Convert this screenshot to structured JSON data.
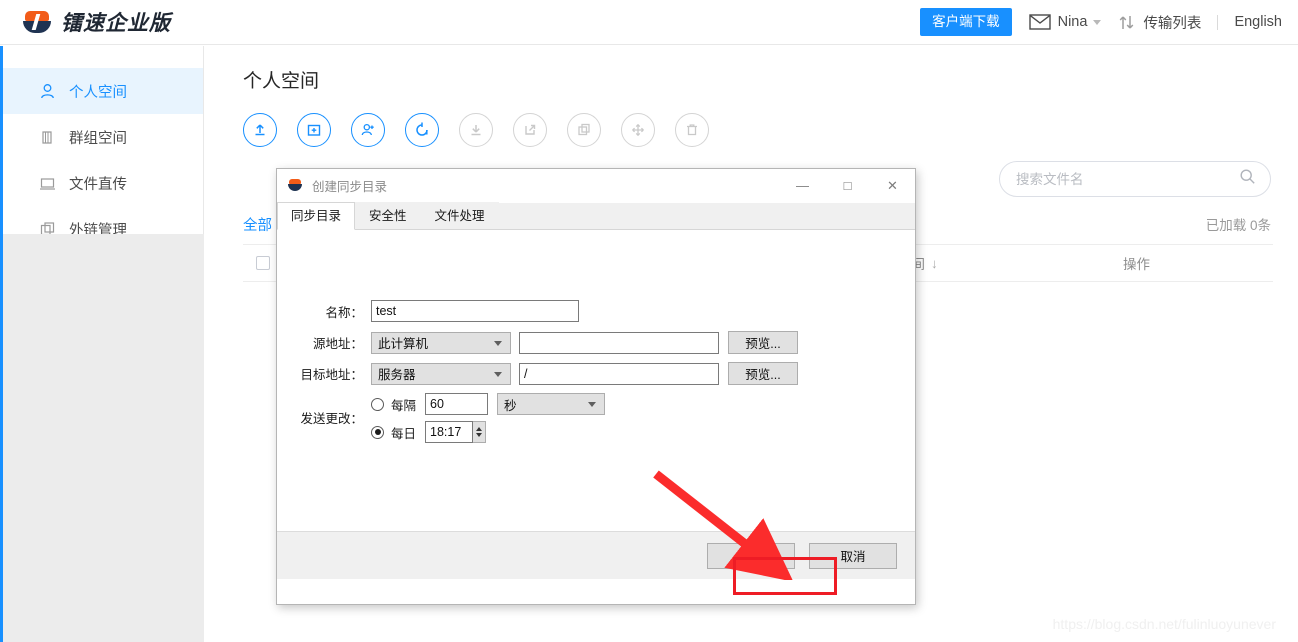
{
  "header": {
    "logo_text": "镭速企业版",
    "client_download": "客户端下载",
    "mail_icon": "mail-icon",
    "user_name": "Nina",
    "transfer_icon": "transfer-icon",
    "transfer_label": "传输列表",
    "language": "English"
  },
  "sidebar": {
    "items": [
      {
        "label": "个人空间",
        "icon": "person-icon",
        "active": true
      },
      {
        "label": "群组空间",
        "icon": "group-icon",
        "active": false
      },
      {
        "label": "文件直传",
        "icon": "monitor-icon",
        "active": false
      },
      {
        "label": "外链管理",
        "icon": "link-icon",
        "active": false
      }
    ]
  },
  "main": {
    "page_title": "个人空间",
    "toolbar": [
      {
        "name": "upload-icon",
        "label": "上传",
        "enabled": true
      },
      {
        "name": "new-folder-icon",
        "label": "新建文件夹",
        "enabled": true
      },
      {
        "name": "add-user-icon",
        "label": "共享",
        "enabled": true
      },
      {
        "name": "sync-icon",
        "label": "同步",
        "enabled": true
      },
      {
        "name": "download-icon",
        "label": "下载",
        "enabled": false
      },
      {
        "name": "external-link-icon",
        "label": "外链",
        "enabled": false
      },
      {
        "name": "copy-icon",
        "label": "复制",
        "enabled": false
      },
      {
        "name": "move-icon",
        "label": "移动",
        "enabled": false
      },
      {
        "name": "delete-icon",
        "label": "删除",
        "enabled": false
      }
    ],
    "search": {
      "value": "",
      "placeholder": "搜索文件名",
      "icon": "search-icon"
    },
    "tab_all": "全部",
    "loaded_count": "已加载 0条",
    "columns": {
      "time": "时间",
      "sort_arrow": "↓",
      "operation": "操作"
    }
  },
  "dialog": {
    "title": "创建同步目录",
    "icon": "app-icon",
    "window_controls": {
      "minimize": "—",
      "maximize": "□",
      "close": "✕"
    },
    "tabs": [
      {
        "label": "同步目录",
        "active": true
      },
      {
        "label": "安全性",
        "active": false
      },
      {
        "label": "文件处理",
        "active": false
      }
    ],
    "form": {
      "name_label": "名称：",
      "name_value": "test",
      "source_label": "源地址：",
      "source_select": "此计算机",
      "source_path": "",
      "source_browse": "预览...",
      "target_label": "目标地址：",
      "target_select": "服务器",
      "target_path": "/",
      "target_browse": "预览...",
      "send_changes_label": "发送更改：",
      "interval_label": "每隔",
      "interval_value": "60",
      "interval_unit": "秒",
      "interval_selected": false,
      "daily_label": "每日",
      "daily_value": "18:17",
      "daily_selected": true
    },
    "footer": {
      "confirm": "确定",
      "cancel": "取消"
    }
  },
  "annotation": {
    "arrow": "red-arrow",
    "highlight": "red-highlight-box"
  },
  "watermark": "https://blog.csdn.net/fulinluoyunever",
  "colors": {
    "accent": "#1890ff",
    "logo_orange": "#f25c19",
    "logo_navy": "#1f3352",
    "annotation_red": "#ee1c25",
    "sidebar_active_bg": "#e8f4fe"
  }
}
